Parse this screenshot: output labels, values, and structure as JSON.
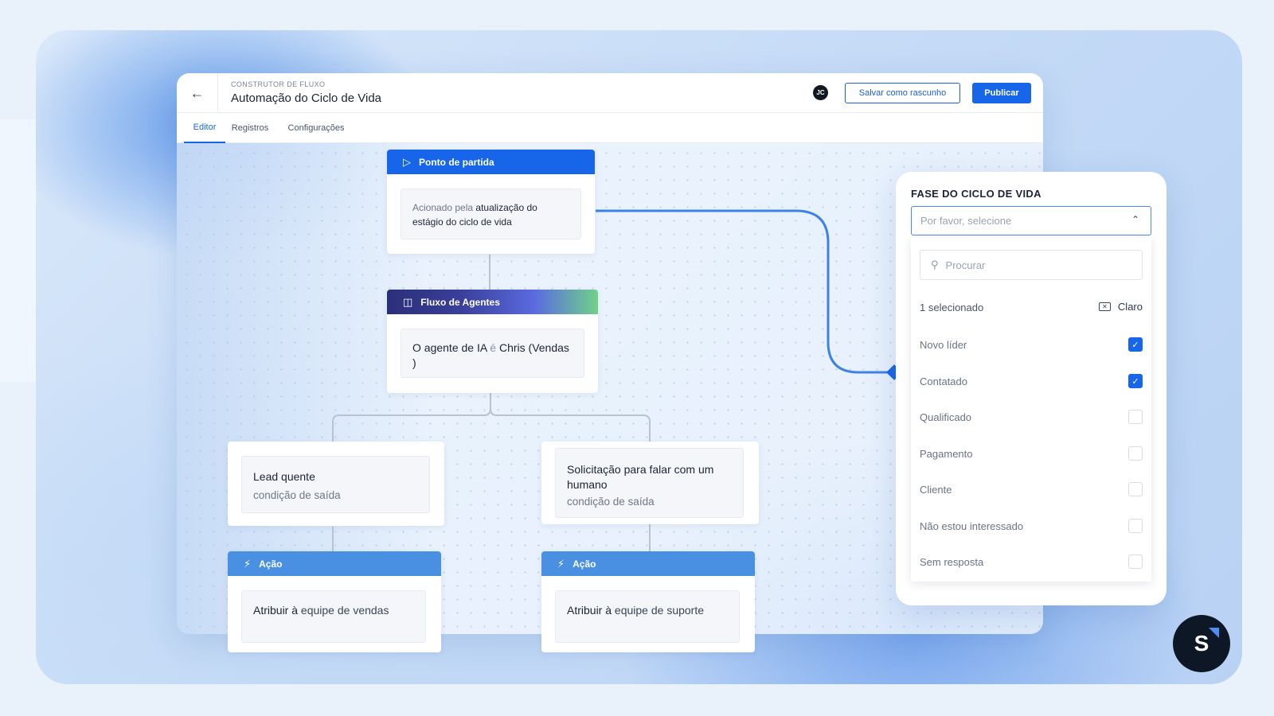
{
  "header": {
    "back_icon": "arrow-left-icon",
    "eyebrow": "CONSTRUTOR DE FLUXO",
    "title": "Automação do Ciclo de Vida",
    "avatar_initials": "JC",
    "draft_label": "Salvar como rascunho",
    "publish_label": "Publicar"
  },
  "tabs": [
    {
      "label": "Editor",
      "active": true
    },
    {
      "label": "Registros",
      "active": false
    },
    {
      "label": "Configurações",
      "active": false
    }
  ],
  "flow": {
    "start": {
      "header": "Ponto de partida",
      "icon": "play-icon",
      "text_light": "Acionado pela ",
      "text_dark": "atualização do estágio do ciclo de vida"
    },
    "agents": {
      "header": "Fluxo de Agentes",
      "icon": "chat-bot-icon",
      "text_1": "O agente de IA ",
      "text_2": "é",
      "text_3": " Chris (Vendas )"
    },
    "lead": {
      "title": "Lead quente",
      "subtitle": "condição de saída"
    },
    "human": {
      "title": "Solicitação para falar com um humano",
      "subtitle": "condição de saída"
    },
    "action_left": {
      "header": "Ação",
      "icon": "bolt-icon",
      "text_1": "Atribuir à",
      "text_2": " equipe de vendas"
    },
    "action_right": {
      "header": "Ação",
      "icon": "bolt-icon",
      "text_1": "Atribuir à",
      "text_2": " equipe de suporte"
    }
  },
  "panel": {
    "title": "FASE DO CICLO DE VIDA",
    "select_placeholder": "Por favor, selecione",
    "search_placeholder": "Procurar",
    "selected_count": "1 selecionado",
    "clear_label": "Claro",
    "options": [
      {
        "label": "Novo líder",
        "checked": true
      },
      {
        "label": "Contatado",
        "checked": true
      },
      {
        "label": "Qualificado",
        "checked": false
      },
      {
        "label": "Pagamento",
        "checked": false
      },
      {
        "label": "Cliente",
        "checked": false
      },
      {
        "label": "Não estou interessado",
        "checked": false
      },
      {
        "label": "Sem resposta",
        "checked": false
      }
    ]
  },
  "brand_letter": "S",
  "colors": {
    "primary": "#1766ea",
    "start_header": "#1766ea",
    "action_header": "#4a90e2",
    "agents_gradient": [
      "#2b2f7a",
      "#5b6be0",
      "#6fd18a"
    ]
  }
}
